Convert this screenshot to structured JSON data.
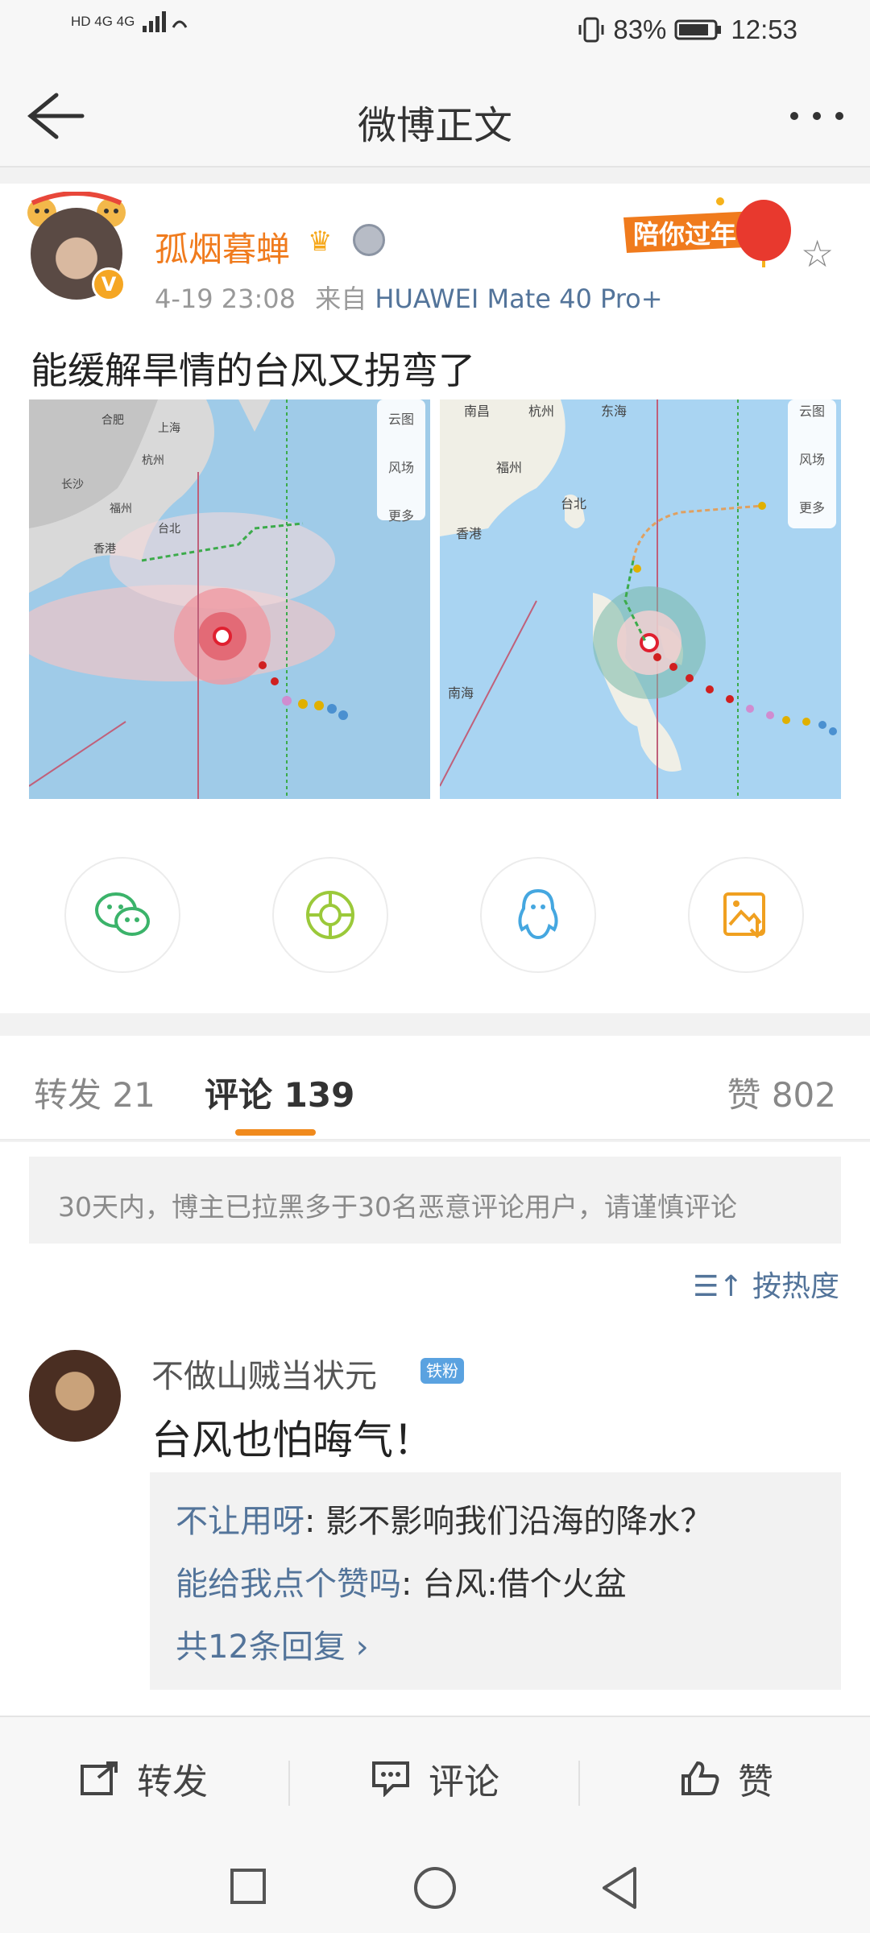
{
  "status_bar": {
    "signal_left": "HD 4G 4G",
    "battery": "83%",
    "time": "12:53"
  },
  "navbar": {
    "title": "微博正文"
  },
  "post": {
    "username": "孤烟暮蝉",
    "date": "4-19 23:08",
    "source_prefix": "来自",
    "device": "HUAWEI Mate 40 Pro+",
    "banner_text": "陪你过年",
    "text": "能缓解旱情的台风又拐弯了",
    "image1_labels": {
      "cloud": "云图",
      "wind": "风场",
      "more": "更多",
      "cities": [
        "合肥",
        "上海",
        "杭州",
        "长沙",
        "福州",
        "台北",
        "香港"
      ]
    },
    "image2_labels": {
      "cloud": "云图",
      "wind": "风场",
      "more": "更多",
      "cities": [
        "南昌",
        "杭州",
        "东海",
        "福州",
        "台北",
        "香港",
        "南海"
      ]
    }
  },
  "tabs": {
    "repost": "转发 21",
    "comment": "评论 139",
    "like": "赞 802"
  },
  "notice": "30天内，博主已拉黑多于30名恶意评论用户，请谨慎评论",
  "sort_label": "按热度",
  "comment": {
    "name": "不做山贼当状元",
    "badge": "铁粉",
    "text": "台风也怕晦气！",
    "replies": [
      {
        "name": "不让用呀",
        "text": ": 影不影响我们沿海的降水？"
      },
      {
        "name": "能给我点个赞吗",
        "text": ": 台风:借个火盆"
      }
    ],
    "more_replies": "共12条回复 ›"
  },
  "actions": {
    "repost": "转发",
    "comment": "评论",
    "like": "赞"
  }
}
